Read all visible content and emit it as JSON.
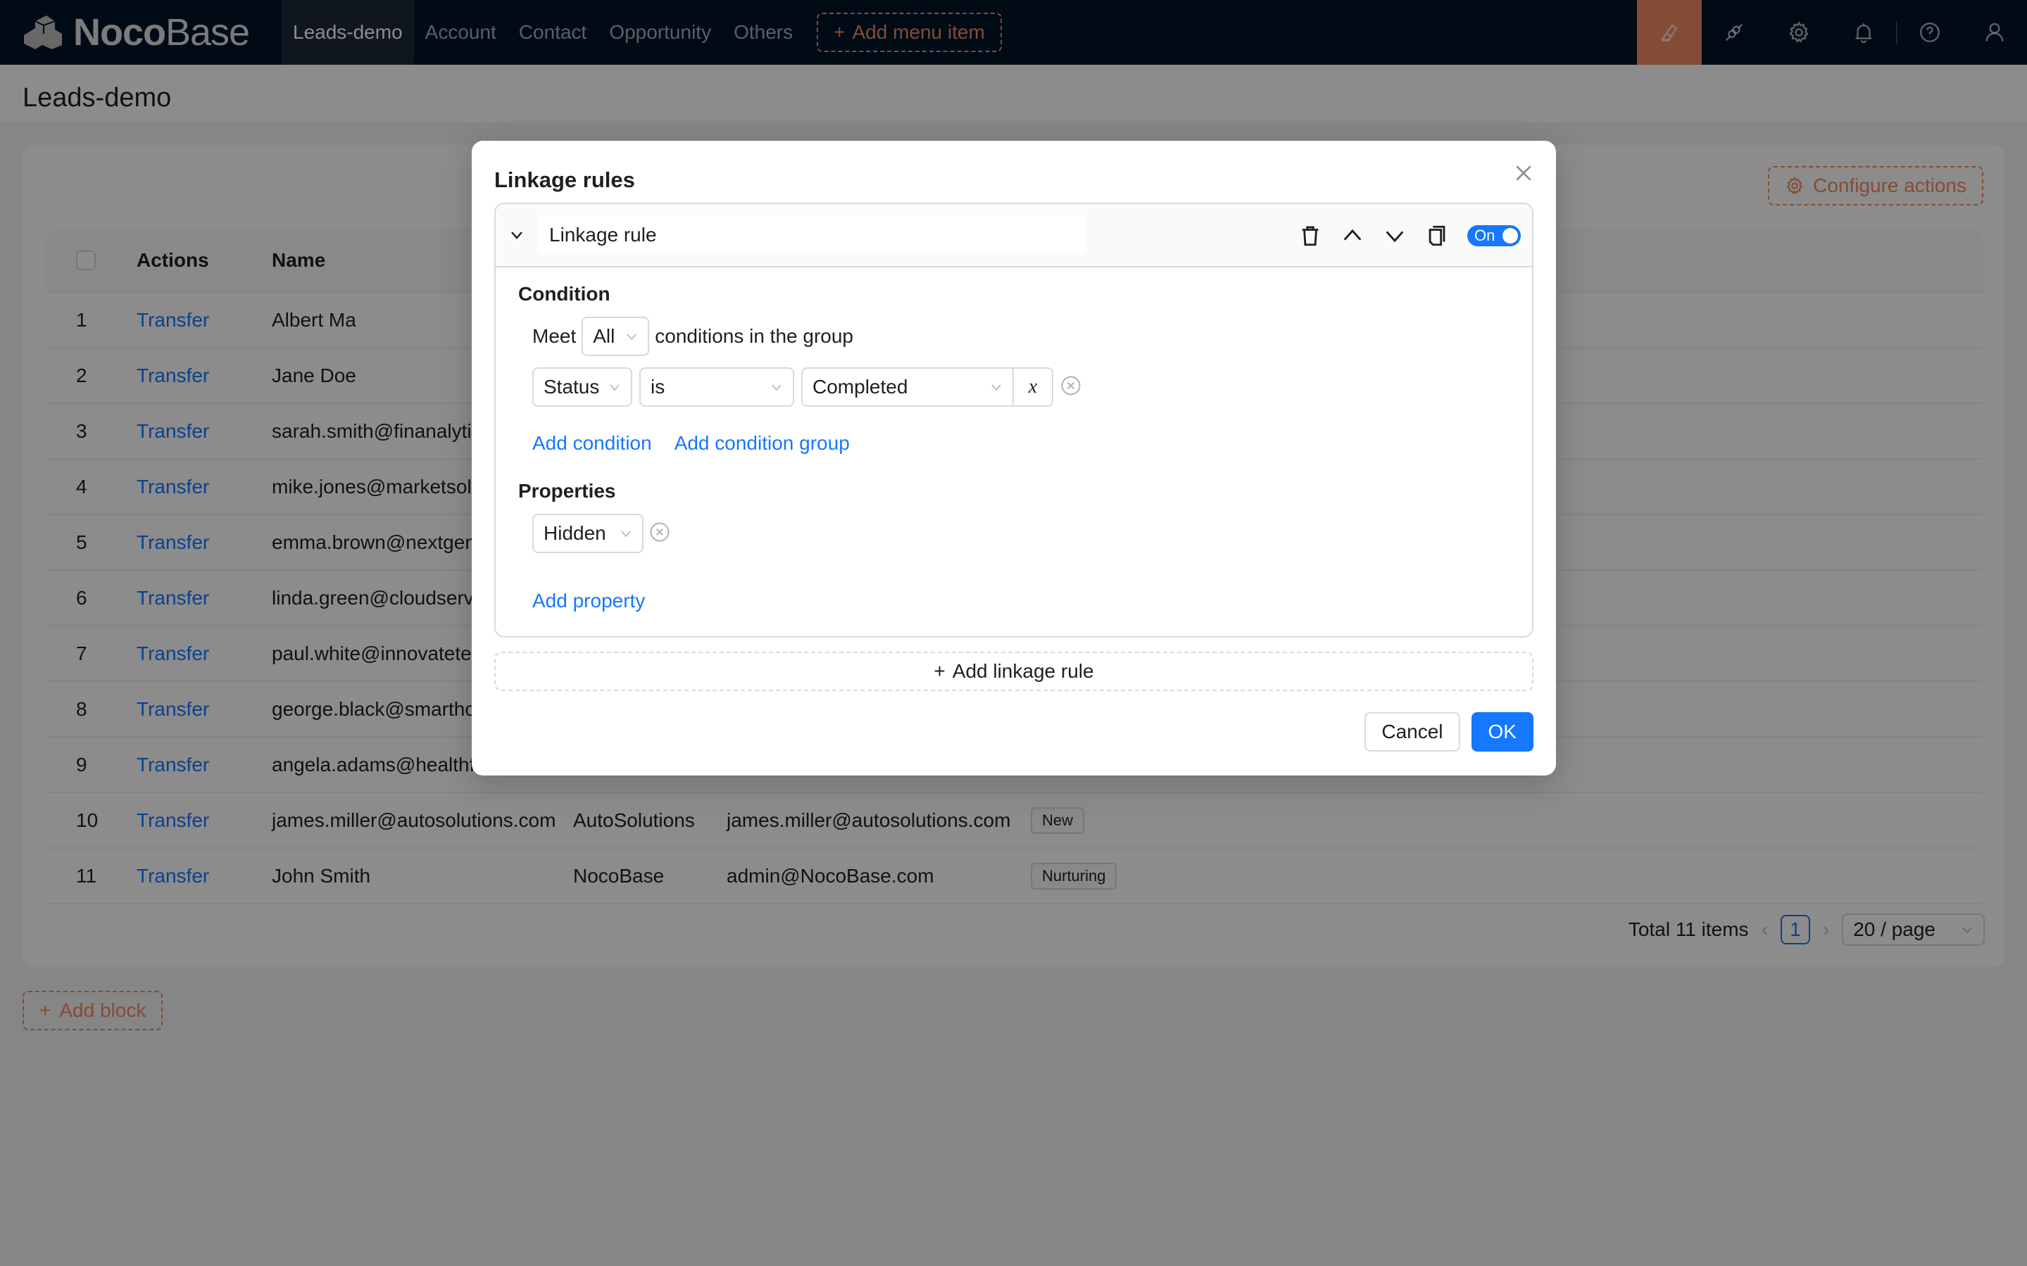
{
  "app": {
    "logo_bold": "Noco",
    "logo_light": "Base",
    "nav": [
      {
        "label": "Leads-demo",
        "active": true
      },
      {
        "label": "Account",
        "active": false
      },
      {
        "label": "Contact",
        "active": false
      },
      {
        "label": "Opportunity",
        "active": false
      },
      {
        "label": "Others",
        "active": false
      }
    ],
    "add_menu_item": "Add menu item",
    "toolbar_icons": [
      "ui-editor-icon",
      "plugin-icon",
      "settings-icon",
      "notification-icon",
      "help-icon",
      "user-icon"
    ],
    "accent_color": "#f18b62",
    "primary_color": "#1677ff"
  },
  "page": {
    "title": "Leads-demo",
    "configure_actions": "Configure actions",
    "add_block": "Add block"
  },
  "table": {
    "columns": [
      "Actions",
      "Name"
    ],
    "rows": [
      {
        "index": "1",
        "action": "Transfer",
        "name": "Albert Ma",
        "company": "",
        "email": "",
        "status": ""
      },
      {
        "index": "2",
        "action": "Transfer",
        "name": "Jane Doe",
        "company": "",
        "email": "",
        "status": ""
      },
      {
        "index": "3",
        "action": "Transfer",
        "name": "sarah.smith@finanalytic",
        "company": "",
        "email": "",
        "status": ""
      },
      {
        "index": "4",
        "action": "Transfer",
        "name": "mike.jones@marketsolu",
        "company": "",
        "email": "",
        "status": ""
      },
      {
        "index": "5",
        "action": "Transfer",
        "name": "emma.brown@nextgen",
        "company": "",
        "email": "",
        "status": ""
      },
      {
        "index": "6",
        "action": "Transfer",
        "name": "linda.green@cloudservi",
        "company": "",
        "email": "",
        "status": ""
      },
      {
        "index": "7",
        "action": "Transfer",
        "name": "paul.white@innovatete",
        "company": "",
        "email": "",
        "status": ""
      },
      {
        "index": "8",
        "action": "Transfer",
        "name": "george.black@smartho",
        "company": "",
        "email": "",
        "status": ""
      },
      {
        "index": "9",
        "action": "Transfer",
        "name": "angela.adams@healthfi",
        "company": "",
        "email": "",
        "status": ""
      },
      {
        "index": "10",
        "action": "Transfer",
        "name": "james.miller@autosolutions.com",
        "company": "AutoSolutions",
        "email": "james.miller@autosolutions.com",
        "status": "New"
      },
      {
        "index": "11",
        "action": "Transfer",
        "name": "John Smith",
        "company": "NocoBase",
        "email": "admin@NocoBase.com",
        "status": "Nurturing"
      }
    ],
    "pagination": {
      "total_label": "Total 11 items",
      "current_page": "1",
      "page_size": "20 / page"
    }
  },
  "modal": {
    "title": "Linkage rules",
    "rule": {
      "title_value": "Linkage rule",
      "enabled_label": "On",
      "enabled": true,
      "condition": {
        "section_label": "Condition",
        "meet_prefix": "Meet",
        "meet_value": "All",
        "meet_suffix": "conditions in the group",
        "items": [
          {
            "field": "Status",
            "operator": "is",
            "value": "Completed",
            "variable_button": "x"
          }
        ],
        "add_condition": "Add condition",
        "add_condition_group": "Add condition group"
      },
      "properties": {
        "section_label": "Properties",
        "items": [
          {
            "value": "Hidden"
          }
        ],
        "add_property": "Add property"
      }
    },
    "add_linkage_rule": "Add linkage rule",
    "cancel": "Cancel",
    "ok": "OK"
  }
}
